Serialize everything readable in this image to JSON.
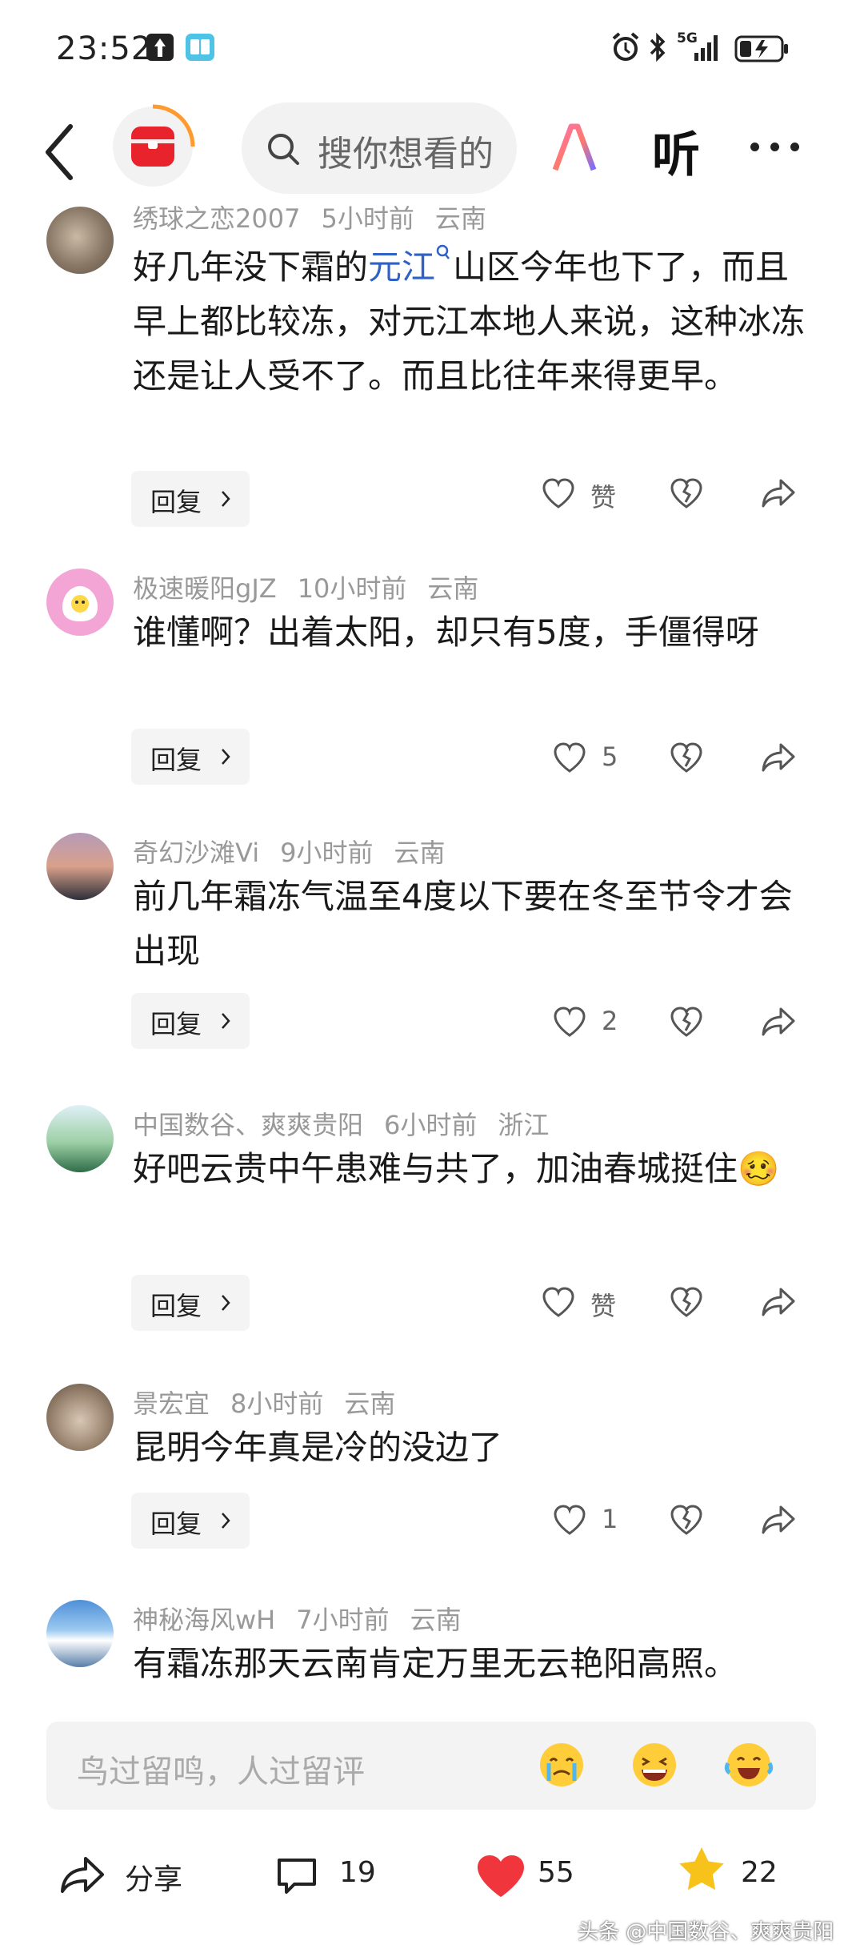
{
  "status_bar": {
    "time": "23:52",
    "left_icons": [
      "upload-icon",
      "book-app-icon"
    ],
    "right_icons": [
      "alarm-icon",
      "bluetooth-icon",
      "5g-signal-icon",
      "battery-charging-icon"
    ],
    "network": "5G"
  },
  "nav": {
    "search_placeholder": "搜你想看的",
    "ai_label": "AI",
    "listen_label": "听"
  },
  "comments": [
    {
      "user": "绣球之恋2007",
      "time": "5小时前",
      "location": "云南",
      "text_before": "好几年没下霜的",
      "text_link": "元江",
      "text_after": "山区今年也下了，而且早上都比较冻，对元江本地人来说，这种冰冻还是让人受不了。而且比往年来得更早。",
      "reply_label": "回复",
      "likes": "赞"
    },
    {
      "user": "极速暖阳gJZ",
      "time": "10小时前",
      "location": "云南",
      "text": "谁懂啊？出着太阳，却只有5度，手僵得呀",
      "reply_label": "回复",
      "likes": "5"
    },
    {
      "user": "奇幻沙滩Vi",
      "time": "9小时前",
      "location": "云南",
      "text": "前几年霜冻气温至4度以下要在冬至节令才会出现",
      "reply_label": "回复",
      "likes": "2"
    },
    {
      "user": "中国数谷、爽爽贵阳",
      "time": "6小时前",
      "location": "浙江",
      "text": "好吧云贵中午患难与共了，加油春城挺住",
      "emoji": "🥴",
      "reply_label": "回复",
      "likes": "赞"
    },
    {
      "user": "景宏宜",
      "time": "8小时前",
      "location": "云南",
      "text": "昆明今年真是冷的没边了",
      "reply_label": "回复",
      "likes": "1"
    },
    {
      "user": "神秘海风wH",
      "time": "7小时前",
      "location": "云南",
      "text": "有霜冻那天云南肯定万里无云艳阳高照。"
    }
  ],
  "input": {
    "placeholder": "鸟过留鸣，人过留评",
    "emojis": [
      "crying-emoji",
      "laughing-emoji",
      "tears-of-joy-emoji"
    ]
  },
  "footer": {
    "share_label": "分享",
    "comment_count": "19",
    "like_count": "55",
    "favorite_count": "22"
  },
  "watermark": "头条 @中国数谷、爽爽贵阳",
  "colors": {
    "link": "#2f61c6",
    "heart_red": "#f0353d",
    "star_yellow": "#f7c21a",
    "logo_red": "#e8232c"
  }
}
